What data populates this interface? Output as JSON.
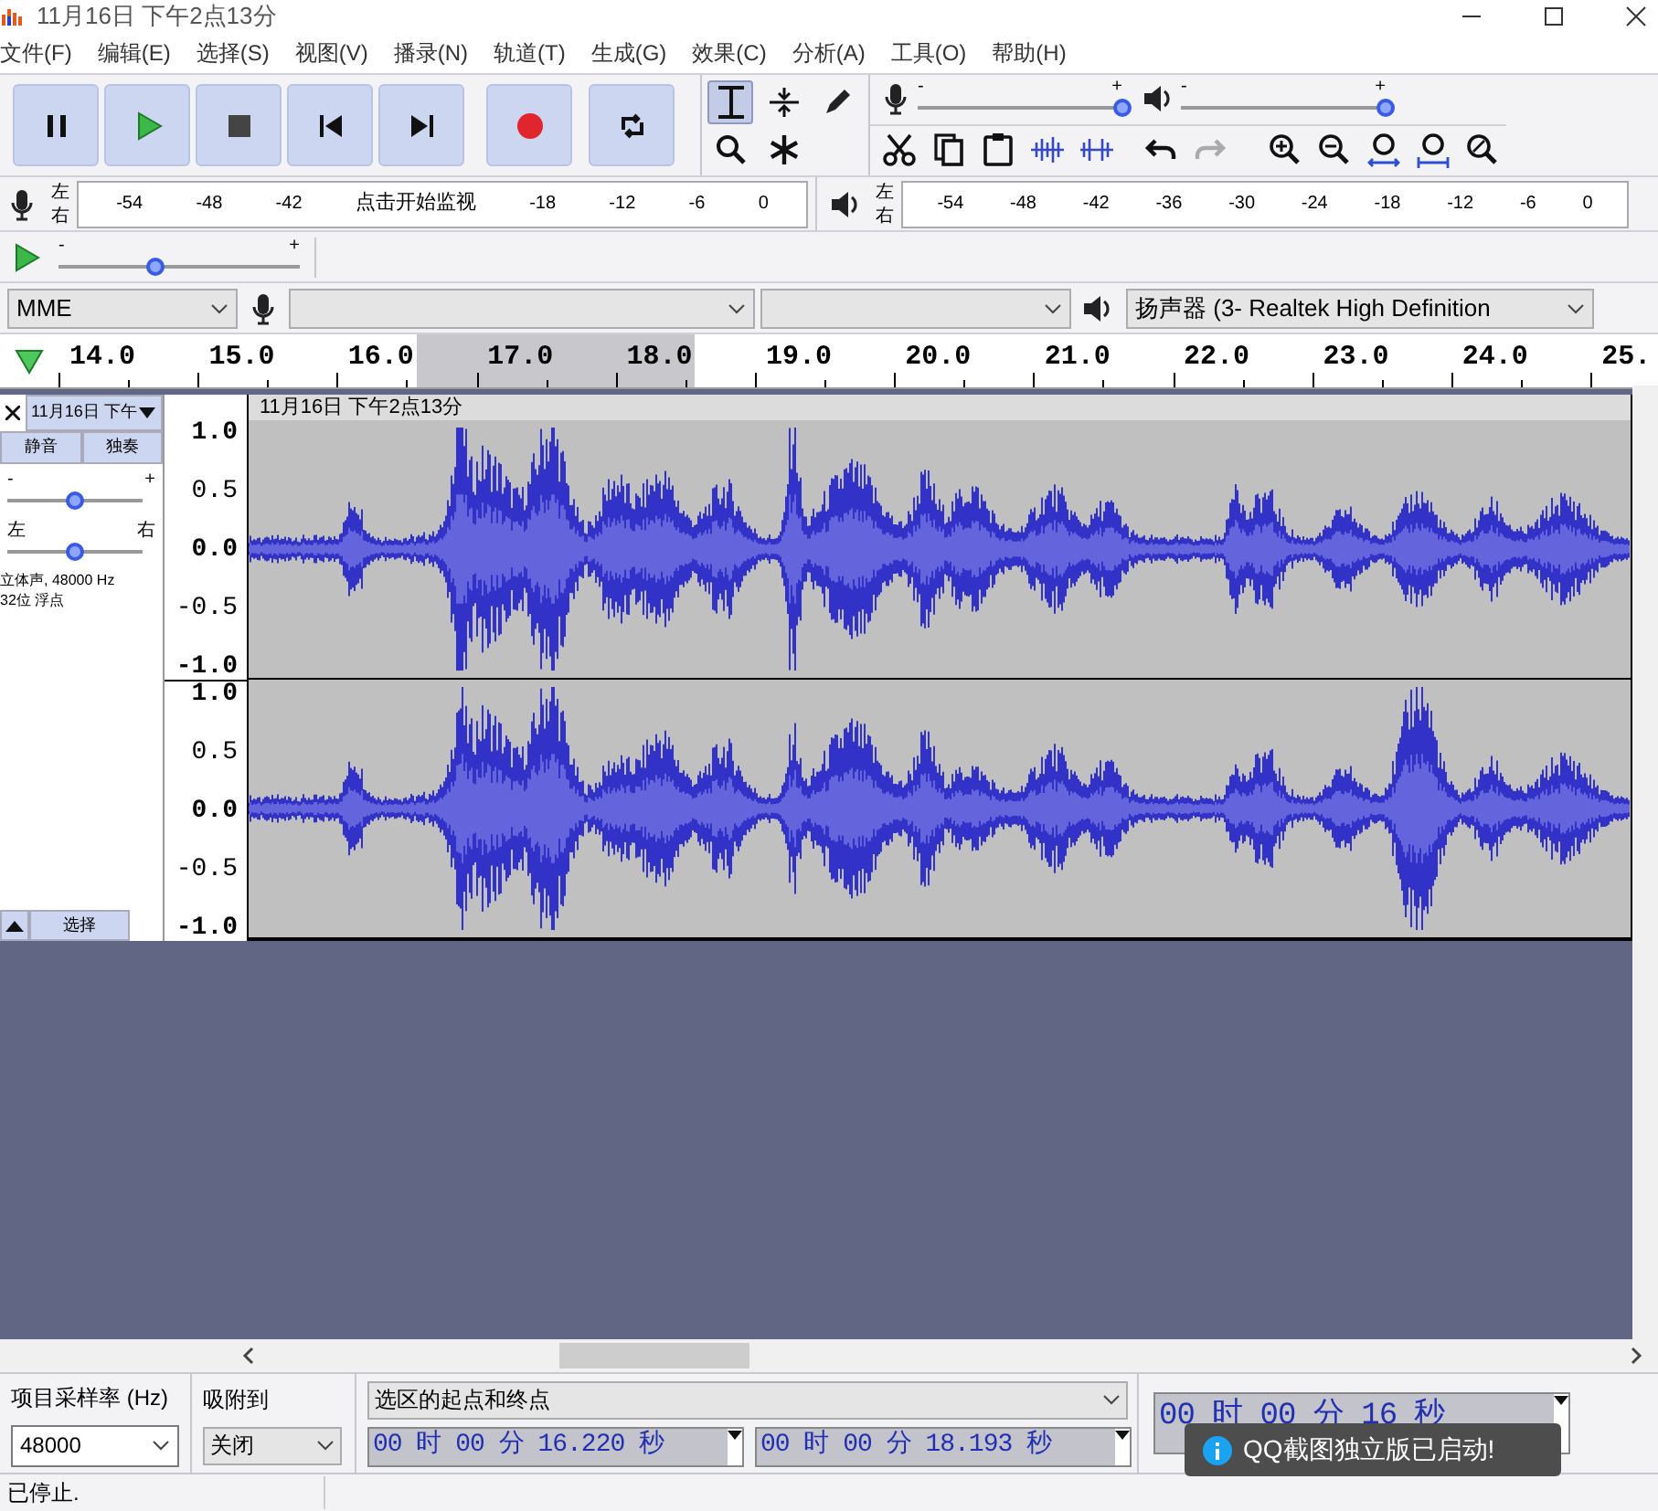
{
  "window": {
    "title": "11月16日 下午2点13分"
  },
  "menu": [
    "文件(F)",
    "编辑(E)",
    "选择(S)",
    "视图(V)",
    "播录(N)",
    "轨道(T)",
    "生成(G)",
    "效果(C)",
    "分析(A)",
    "工具(O)",
    "帮助(H)"
  ],
  "tools": [
    {
      "kind": "select",
      "selected": true
    },
    {
      "kind": "envelope",
      "selected": false
    },
    {
      "kind": "draw",
      "selected": false
    },
    {
      "kind": "zoom",
      "selected": false
    },
    {
      "kind": "multi",
      "selected": false
    }
  ],
  "mixer": [
    {
      "kind": "record",
      "min": "-",
      "max": "+",
      "level": 1.0
    },
    {
      "kind": "play",
      "min": "-",
      "max": "+",
      "level": 1.0
    }
  ],
  "meters": [
    {
      "kind": "record",
      "channels": [
        "左",
        "右"
      ],
      "ticks": [
        "-54",
        "-48",
        "-42",
        "-18",
        "-12",
        "-6",
        "0"
      ],
      "prompt": "点击开始监视"
    },
    {
      "kind": "play",
      "channels": [
        "左",
        "右"
      ],
      "ticks": [
        "-54",
        "-48",
        "-42",
        "-36",
        "-30",
        "-24",
        "-18",
        "-12",
        "-6",
        "0"
      ]
    }
  ],
  "play_at_speed": {
    "min": "-",
    "max": "+",
    "level": 0.4
  },
  "devices": {
    "host": "MME",
    "playback": "扬声器 (3- Realtek High Definition"
  },
  "ruler": {
    "ticks": [
      "14.0",
      "15.0",
      "16.0",
      "17.0",
      "18.0",
      "19.0",
      "20.0",
      "21.0",
      "22.0",
      "23.0",
      "24.0",
      "25."
    ]
  },
  "track": {
    "name": "11月16日 下午",
    "mute": "静音",
    "solo": "独奏",
    "gain": {
      "min": "-",
      "max": "+",
      "level": 0.5
    },
    "pan": {
      "min": "左",
      "max": "右",
      "level": 0.5
    },
    "info": [
      "立体声, 48000 Hz",
      "32位 浮点"
    ],
    "select": "选择",
    "clip_title": "11月16日 下午2点13分",
    "channels": [
      {
        "scale": [
          "1.0",
          "0.5",
          "0.0",
          "-0.5",
          "-1.0"
        ]
      },
      {
        "scale": [
          "1.0",
          "0.5",
          "0.0",
          "-0.5",
          "-1.0"
        ]
      }
    ]
  },
  "selection_toolbar": {
    "rate_label": "项目采样率 (Hz)",
    "rate": "48000",
    "snap_label": "吸附到",
    "snap": "关闭",
    "mode": "选区的起点和终点",
    "start": "00 时 00 分 16.220 秒",
    "end": "00 时 00 分 18.193 秒",
    "time": "00 时 00 分 16 秒"
  },
  "status_bar": "已停止.",
  "toast": "QQ截图独立版已启动!"
}
